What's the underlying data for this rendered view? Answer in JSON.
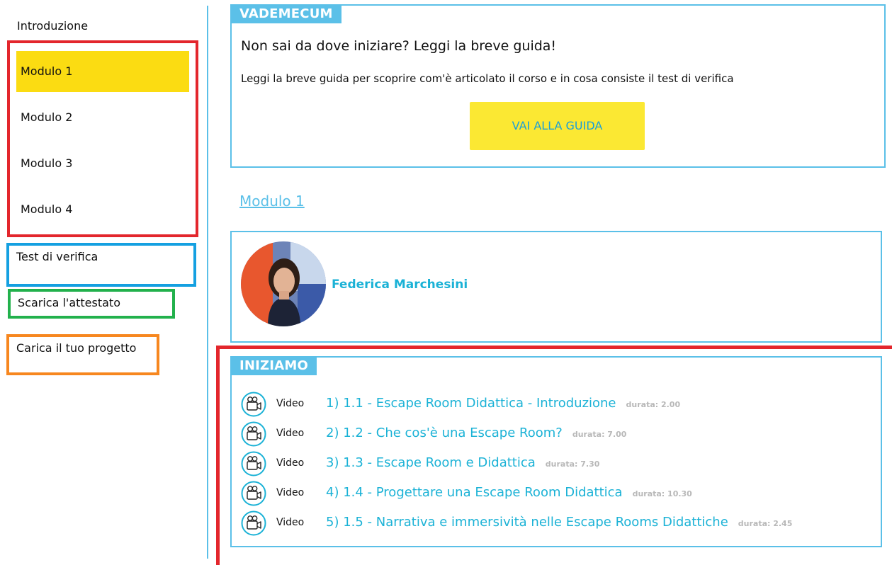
{
  "sidebar": {
    "intro": "Introduzione",
    "modules": [
      "Modulo 1",
      "Modulo 2",
      "Modulo 3",
      "Modulo 4"
    ],
    "active_module": "Modulo 1",
    "test": "Test di verifica",
    "certificate": "Scarica l'attestato",
    "upload": "Carica il tuo progetto"
  },
  "vademecum": {
    "tag": "VADEMECUM",
    "title": "Non sai da dove iniziare? Leggi la breve guida!",
    "text": "Leggi la breve guida per scoprire com'è articolato il corso e in cosa consiste il test di verifica",
    "button": "VAI ALLA GUIDA"
  },
  "module_link": "Modulo 1",
  "teacher": {
    "name": "Federica Marchesini"
  },
  "start": {
    "tag": "INIZIAMO",
    "lessons": [
      {
        "type": "Video",
        "title": "1) 1.1 - Escape Room Didattica - Introduzione",
        "duration": "durata: 2.00"
      },
      {
        "type": "Video",
        "title": "2) 1.2 - Che cos'è una Escape Room?",
        "duration": "durata: 7.00"
      },
      {
        "type": "Video",
        "title": "3) 1.3 - Escape Room e Didattica",
        "duration": "durata: 7.30"
      },
      {
        "type": "Video",
        "title": "4) 1.4 - Progettare una Escape Room Didattica",
        "duration": "durata: 10.30"
      },
      {
        "type": "Video",
        "title": "5) 1.5 - Narrativa e immersività nelle Escape Rooms Didattiche",
        "duration": "durata: 2.45"
      }
    ]
  },
  "colors": {
    "accent_blue": "#5bc0e8",
    "link_teal": "#1bb2d6",
    "highlight_yellow": "#fbdc12",
    "annotation_red": "#e3262c",
    "annotation_blue": "#14a0e1",
    "annotation_green": "#22b14c",
    "annotation_orange": "#f7871f"
  },
  "icons": {
    "lesson": "video-camera-icon"
  }
}
